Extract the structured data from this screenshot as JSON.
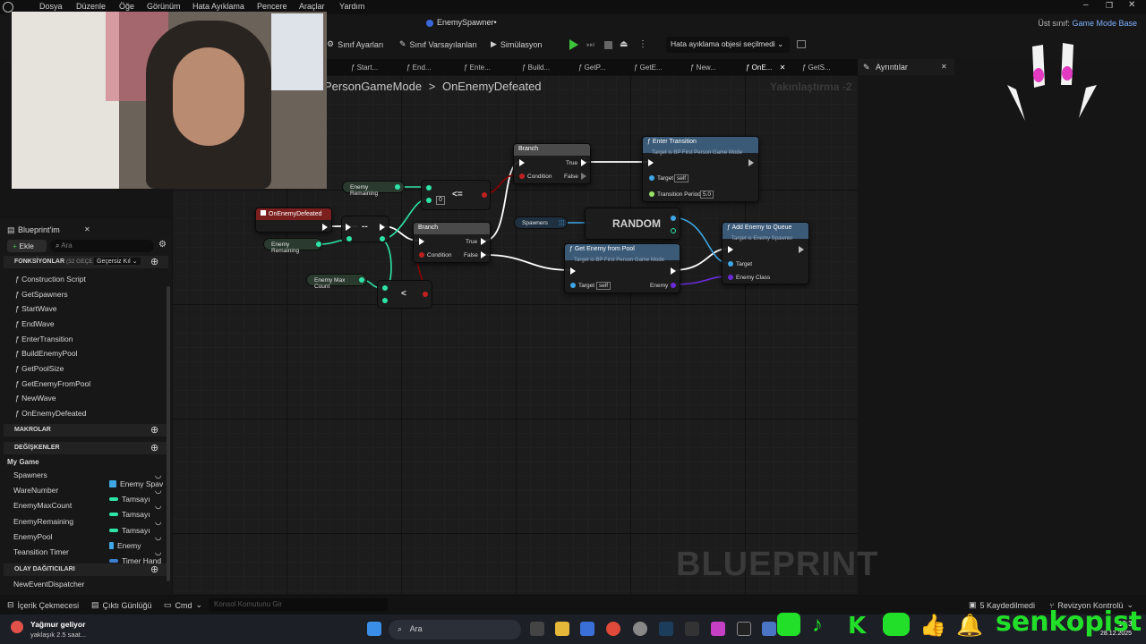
{
  "menu": [
    "Dosya",
    "Düzenle",
    "Öğe",
    "Görünüm",
    "Hata Ayıklama",
    "Pencere",
    "Araçlar",
    "Yardım"
  ],
  "document_tab": "EnemySpawner•",
  "title_right": {
    "parent_label": "Üst sınıf:",
    "parent_value": "Game Mode Base"
  },
  "toolbar": {
    "class_settings": "Sınıf Ayarları",
    "class_defaults": "Sınıf Varsayılanları",
    "simulation": "Simülasyon",
    "debug_object": "Hata ayıklama objesi seçilmedi"
  },
  "graph_tabs": [
    "Start...",
    "End...",
    "Ente...",
    "Build...",
    "GetP...",
    "GetE...",
    "New...",
    "OnE...",
    "GetS..."
  ],
  "details_tab": "Ayrıntılar",
  "breadcrumb": {
    "parent": "PersonGameMode",
    "sep": ">",
    "current": "OnEnemyDefeated"
  },
  "zoom": "Yakınlaştırma -2",
  "watermark": "BLUEPRINT",
  "nodes": {
    "event": "OnEnemyDefeated",
    "enemy_remaining_1": "Enemy Remaining",
    "enemy_remaining_2": "Enemy Remaining",
    "enemy_max_count": "Enemy Max Count",
    "decrement": "--",
    "lte": "<=",
    "lte_value": "0",
    "lt": "<",
    "branch1": {
      "title": "Branch",
      "true": "True",
      "false": "False",
      "condition": "Condition"
    },
    "branch2": {
      "title": "Branch",
      "true": "True",
      "false": "False",
      "condition": "Condition"
    },
    "enter_transition": {
      "title": "Enter Transition",
      "sub": "Target is BP First Person Game Mode",
      "target": "Target",
      "target_val": "self",
      "period": "Transition Period",
      "period_val": "5.0"
    },
    "spawners": "Spawners",
    "random": "RANDOM",
    "get_enemy": {
      "title": "Get Enemy from Pool",
      "sub": "Target is BP First Person Game Mode",
      "target": "Target",
      "target_val": "self",
      "enemy": "Enemy"
    },
    "add_enemy": {
      "title": "Add Enemy to Queue",
      "sub": "Target is Enemy Spawner",
      "target": "Target",
      "enemy_class": "Enemy Class"
    }
  },
  "left_panel": {
    "title": "Blueprint'im",
    "add": "Ekle",
    "search_placeholder": "Ara",
    "functions_header": "FONKSİYONLAR",
    "functions_count": "(32 GEÇE",
    "override": "Geçersiz Kıl",
    "functions": [
      "Construction Script",
      "GetSpawners",
      "StartWave",
      "EndWave",
      "EnterTransition",
      "BuildEnemyPool",
      "GetPoolSize",
      "GetEnemyFromPool",
      "NewWave",
      "OnEnemyDefeated"
    ],
    "macros_header": "MAKROLAR",
    "variables_header": "DEĞİŞKENLER",
    "variables_group": "My Game",
    "variables": [
      {
        "name": "Spawners",
        "type": "Enemy Spav",
        "color": "#3fa7e6"
      },
      {
        "name": "WareNumber",
        "type": "Tamsayı",
        "color": "#2ee4a8"
      },
      {
        "name": "EnemyMaxCount",
        "type": "Tamsayı",
        "color": "#2ee4a8"
      },
      {
        "name": "EnemyRemaining",
        "type": "Tamsayı",
        "color": "#2ee4a8"
      },
      {
        "name": "EnemyPool",
        "type": "Enemy",
        "color": "#3fa7e6"
      },
      {
        "name": "Teansition Timer",
        "type": "Timer Hand",
        "color": "#3a7fd0"
      }
    ],
    "dispatchers_header": "OLAY DAĞITICILARI",
    "dispatchers": [
      "NewEventDispatcher"
    ]
  },
  "statusbar": {
    "content_drawer": "İçerik Çekmecesi",
    "output_log": "Çıktı Günlüğü",
    "cmd": "Cmd",
    "console_placeholder": "Konsol Komutunu Gir",
    "saved": "5 Kaydedilmedi",
    "revision": "Revizyon Kontrolü"
  },
  "taskbar": {
    "weather_title": "Yağmur geliyor",
    "weather_sub": "yaklaşık 2.5 saat...",
    "search": "Ara",
    "time": "10:33",
    "date": "28.12.2025"
  },
  "overlay": {
    "brand": "senkopist"
  },
  "colors": {
    "exec": "#ffffff",
    "bool": "#8c0000",
    "int": "#2ee4a8",
    "object": "#3fa7e6",
    "class": "#6a2bd8",
    "event_head": "#7a1e1e",
    "func_head": "#3a5a78"
  }
}
